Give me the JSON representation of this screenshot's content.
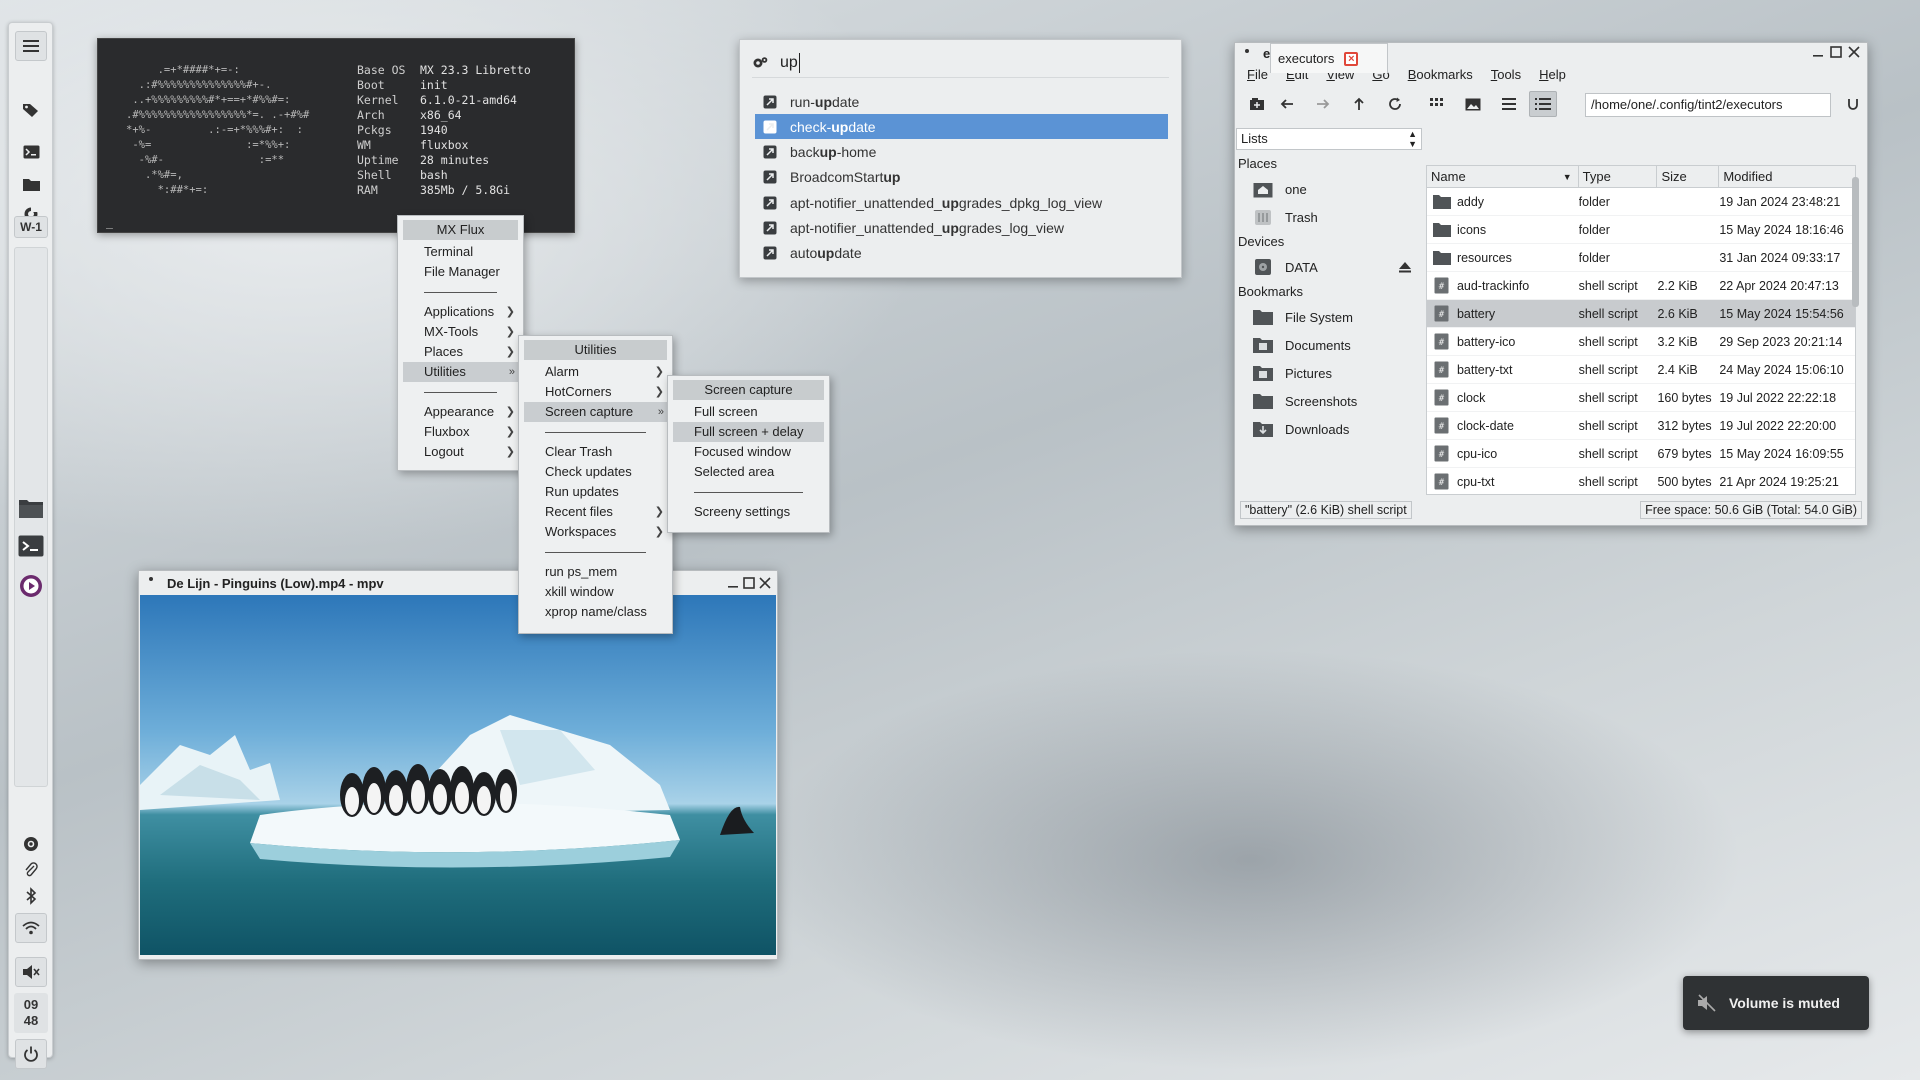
{
  "panel": {
    "workspace_label": "W-1",
    "clock": {
      "hour": "09",
      "minute": "48"
    },
    "icons": [
      "menu-icon",
      "tags-icon",
      "terminal-icon",
      "folder-icon",
      "refresh-icon",
      "file-manager-icon",
      "terminal-app-icon",
      "media-player-icon",
      "at-sign-icon",
      "paperclip-icon",
      "bluetooth-icon",
      "wifi-icon",
      "volume-muted-icon",
      "power-icon"
    ]
  },
  "terminal": {
    "art": "     .=+*####*+=-:\n  .:#%%%%%%%%%%%%%%#+-.\n ..+%%%%%%%%%#*+==+*#%%#=:\n.#%%%%%%%%%%%%%%%%%*=. .-+#%#\n*+%-         .:-=+*%%%#+:  :\n -%=               :=*%%+:\n  -%#-               :=**\n   .*%#=,\n     *:##*+=:",
    "info": [
      {
        "key": "Base OS",
        "value": "MX 23.3 Libretto"
      },
      {
        "key": "Boot",
        "value": "init"
      },
      {
        "key": "Kernel",
        "value": "6.1.0-21-amd64"
      },
      {
        "key": "Arch",
        "value": "x86_64"
      },
      {
        "key": "Pckgs",
        "value": "1940"
      },
      {
        "key": "WM",
        "value": "fluxbox"
      },
      {
        "key": "Uptime",
        "value": "28 minutes"
      },
      {
        "key": "Shell",
        "value": "bash"
      },
      {
        "key": "RAM",
        "value": "385Mb / 5.8Gi"
      }
    ],
    "cursor": "_"
  },
  "root_menu": {
    "title": "MX Flux",
    "items": [
      "Terminal",
      "File Manager",
      "Applications",
      "MX-Tools",
      "Places",
      "Utilities",
      "Appearance",
      "Fluxbox",
      "Logout"
    ]
  },
  "utilities_menu": {
    "title": "Utilities",
    "items": [
      "Alarm",
      "HotCorners",
      "Screen capture",
      "Clear Trash",
      "Check updates",
      "Run updates",
      "Recent files",
      "Workspaces",
      "run ps_mem",
      "xkill window",
      "xprop name/class"
    ]
  },
  "capture_menu": {
    "title": "Screen capture",
    "items": [
      "Full screen",
      "Full screen + delay",
      "Focused window",
      "Selected area",
      "Screeny settings"
    ]
  },
  "launcher": {
    "query": "up",
    "results": [
      {
        "pre": "run-",
        "match": "up",
        "post": "date"
      },
      {
        "pre": "check-",
        "match": "up",
        "post": "date"
      },
      {
        "pre": "back",
        "match": "up",
        "post": "-home"
      },
      {
        "pre": "BroadcomStart",
        "match": "up",
        "post": ""
      },
      {
        "pre": "apt-notifier_unattended_",
        "match": "up",
        "post": "grades_dpkg_log_view"
      },
      {
        "pre": "apt-notifier_unattended_",
        "match": "up",
        "post": "grades_log_view"
      },
      {
        "pre": "auto",
        "match": "up",
        "post": "date"
      }
    ]
  },
  "file_manager": {
    "title": "executors",
    "menu": [
      "File",
      "Edit",
      "View",
      "Go",
      "Bookmarks",
      "Tools",
      "Help"
    ],
    "path": "/home/one/.config/tint2/executors",
    "side_mode": "Lists",
    "tab_label": "executors",
    "places_label": "Places",
    "places": [
      "one",
      "Trash"
    ],
    "devices_label": "Devices",
    "devices": [
      "DATA"
    ],
    "bookmarks_label": "Bookmarks",
    "bookmarks": [
      "File System",
      "Documents",
      "Pictures",
      "Screenshots",
      "Downloads"
    ],
    "columns": [
      "Name",
      "Type",
      "Size",
      "Modified"
    ],
    "rows": [
      {
        "name": "addy",
        "type": "folder",
        "size": "",
        "modified": "19 Jan 2024 23:48:21"
      },
      {
        "name": "icons",
        "type": "folder",
        "size": "",
        "modified": "15 May 2024 18:16:46"
      },
      {
        "name": "resources",
        "type": "folder",
        "size": "",
        "modified": "31 Jan 2024 09:33:17"
      },
      {
        "name": "aud-trackinfo",
        "type": "shell script",
        "size": "2.2 KiB",
        "modified": "22 Apr 2024 20:47:13"
      },
      {
        "name": "battery",
        "type": "shell script",
        "size": "2.6 KiB",
        "modified": "15 May 2024 15:54:56"
      },
      {
        "name": "battery-ico",
        "type": "shell script",
        "size": "3.2 KiB",
        "modified": "29 Sep 2023 20:21:14"
      },
      {
        "name": "battery-txt",
        "type": "shell script",
        "size": "2.4 KiB",
        "modified": "24 May 2024 15:06:10"
      },
      {
        "name": "clock",
        "type": "shell script",
        "size": "160 bytes",
        "modified": "19 Jul 2022 22:22:18"
      },
      {
        "name": "clock-date",
        "type": "shell script",
        "size": "312 bytes",
        "modified": "19 Jul 2022 22:20:00"
      },
      {
        "name": "cpu-ico",
        "type": "shell script",
        "size": "679 bytes",
        "modified": "15 May 2024 16:09:55"
      },
      {
        "name": "cpu-txt",
        "type": "shell script",
        "size": "500 bytes",
        "modified": "21 Apr 2024 19:25:21"
      }
    ],
    "selected_row": "battery",
    "status_left": "\"battery\" (2.6 KiB) shell script",
    "status_right": "Free space: 50.6 GiB (Total: 54.0 GiB)"
  },
  "mpv": {
    "title": "De Lijn - Pinguins (Low).mp4 - mpv"
  },
  "toast": {
    "text": "Volume is muted"
  },
  "colors": {
    "selection_blue": "#5b93d5",
    "menu_bg": "#eef0f1",
    "terminal_bg": "#2a2b2d",
    "toast_bg": "#2f3234"
  }
}
